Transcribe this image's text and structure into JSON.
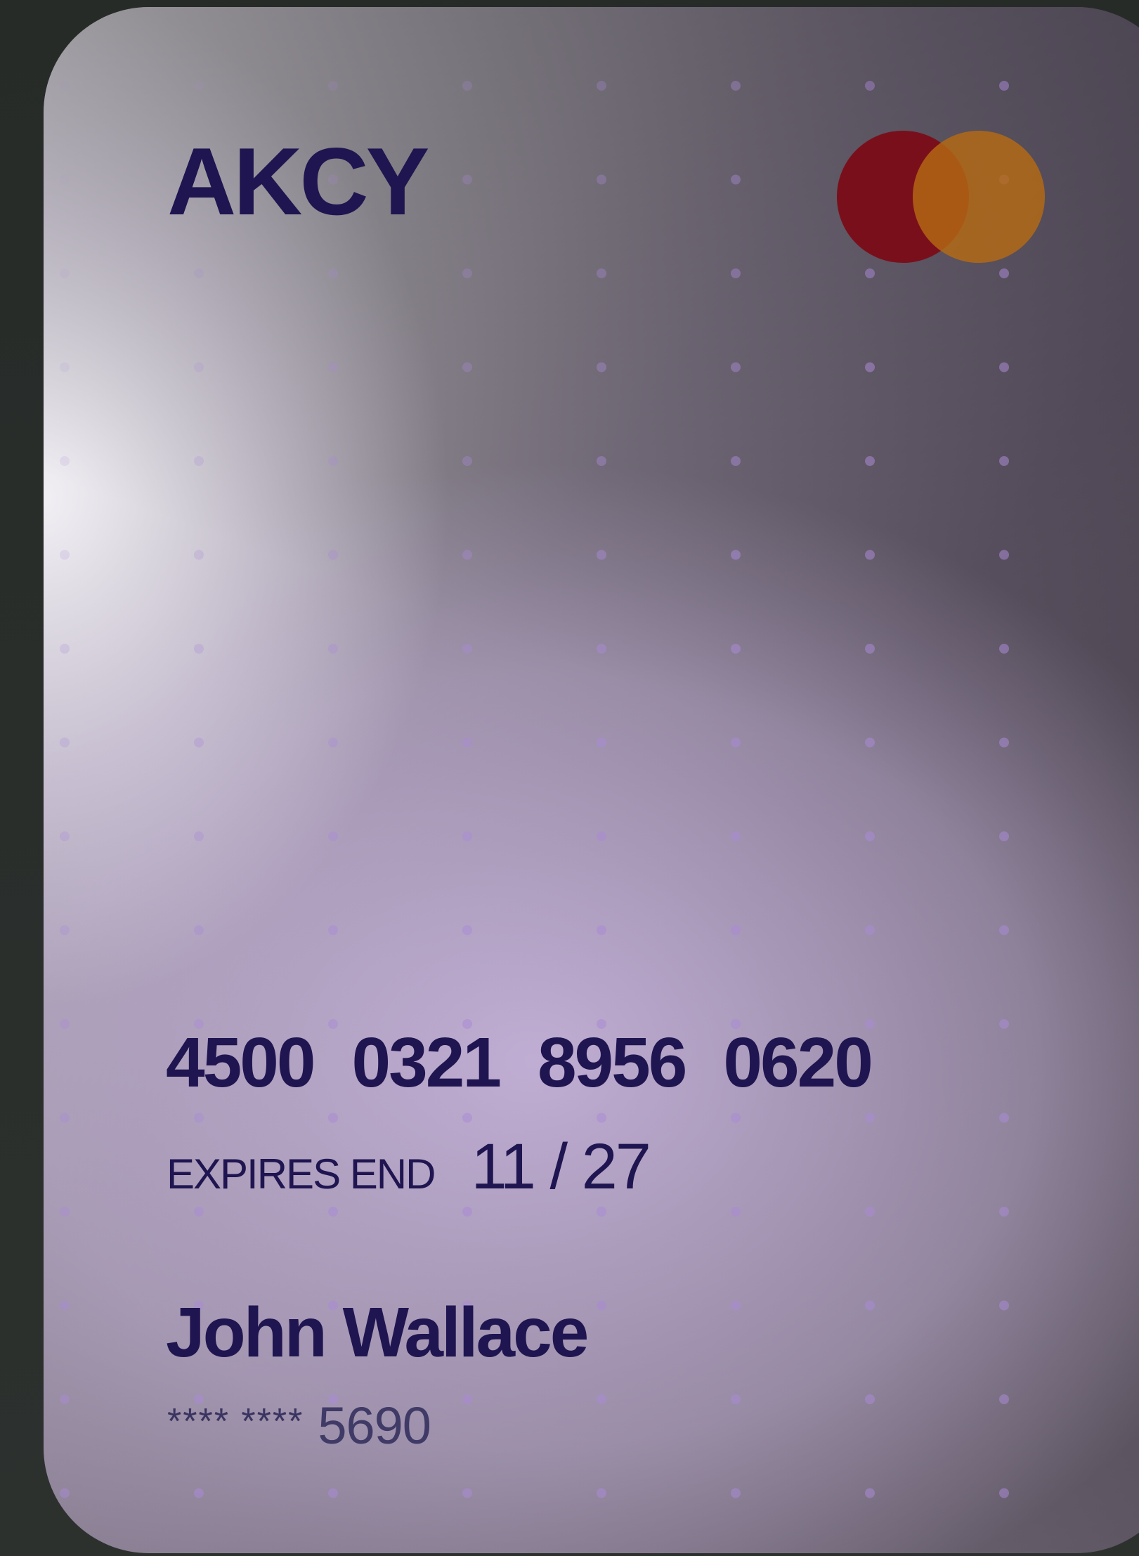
{
  "card": {
    "brand": "AKCY",
    "number_groups": [
      "4500",
      "0321",
      "8956",
      "0620"
    ],
    "expiry_label": "EXPIRES END",
    "expiry_value": "11 / 27",
    "holder_name": "John Wallace",
    "masked_prefix": "**** ****",
    "masked_last4": "5690",
    "network_logo": "mastercard-icon"
  },
  "colors": {
    "text_primary": "#1f1550",
    "logo_left_circle": "#7a0f1c",
    "logo_right_circle": "#b56a14",
    "dot_pattern": "#a98ad6"
  }
}
